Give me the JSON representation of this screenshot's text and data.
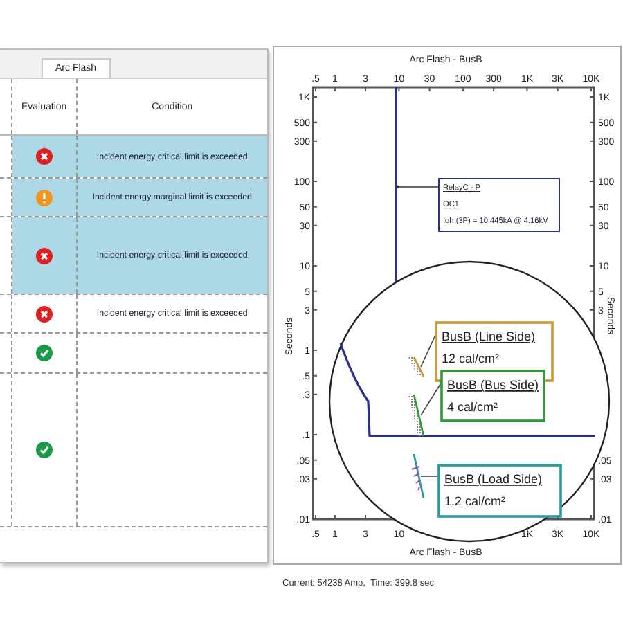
{
  "table": {
    "tab": "Arc Flash",
    "columns": [
      "Evaluation",
      "Condition"
    ],
    "rows": [
      {
        "kind": "critical",
        "condition": "Incident energy critical limit is exceeded",
        "selected": true
      },
      {
        "kind": "marginal",
        "condition": "Incident energy marginal limit is exceeded",
        "selected": true
      },
      {
        "kind": "critical",
        "condition": "Incident energy critical limit is exceeded",
        "selected": true
      },
      {
        "kind": "critical",
        "condition": "Incident energy critical limit is exceeded",
        "selected": false
      },
      {
        "kind": "ok",
        "selected": false
      },
      {
        "kind": "ok",
        "selected": false
      }
    ]
  },
  "plot": {
    "title": "Arc Flash - BusB",
    "xlabel": "Arc Flash - BusB",
    "ylabel": "Seconds",
    "top_tick_labels": [
      ".5",
      "1",
      "3",
      "10",
      "30",
      "100",
      "300",
      "1K",
      "3K",
      "10K"
    ],
    "left_tick_labels": [
      "1K",
      "500",
      "300",
      "100",
      "50",
      "30",
      "10",
      "5",
      "3",
      "1",
      ".5",
      ".3",
      ".1",
      ".05",
      ".03",
      ".01"
    ],
    "bottom_tick_labels": [
      ".5",
      "1",
      "3",
      "10",
      "1K",
      "3K",
      "10K"
    ],
    "right_tick_labels": [
      "1K",
      "500",
      "300",
      "100",
      "50",
      "30",
      "10",
      "5",
      "3",
      ".05",
      ".03",
      ".01"
    ],
    "right_axis_label": "Seconds",
    "relay_label": {
      "lines": [
        "RelayC - P",
        "OC1",
        "Ioh (3P) = 10.445kA @ 4.16kV"
      ]
    },
    "callouts": [
      {
        "title": "BusB (Line Side)",
        "value": "12 cal/cm²",
        "color": "#c89a3a"
      },
      {
        "title": "BusB (Bus Side)",
        "value": "4 cal/cm²",
        "color": "#2e9a3a"
      },
      {
        "title": "BusB (Load Side)",
        "value": "1.2 cal/cm²",
        "color": "#2a9a9a"
      }
    ]
  },
  "status_bar": "Current: 54238 Amp,  Time: 399.8 sec"
}
